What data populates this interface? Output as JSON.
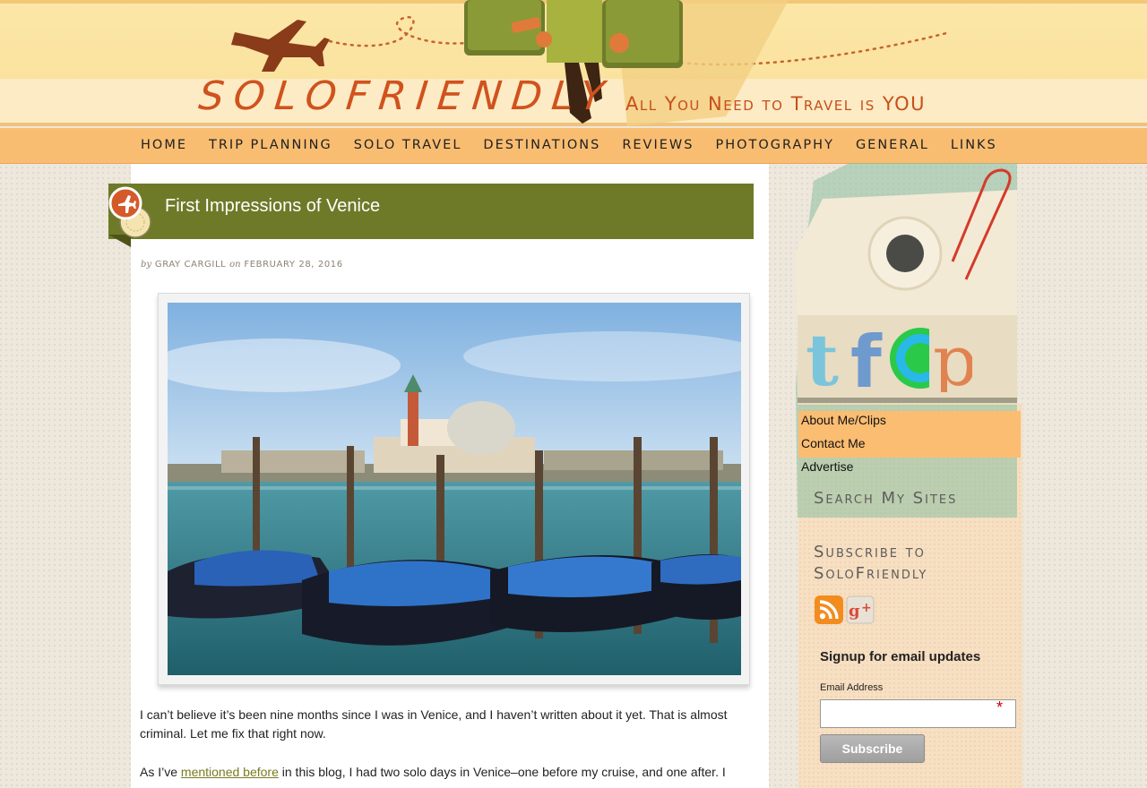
{
  "header": {
    "logo": "SOLOFRIENDLY",
    "tagline": "All You Need to Travel is YOU",
    "colors": {
      "logo": "#d0521d",
      "header_bg": "#fbe7a8",
      "nav_bg": "#f9bd72"
    }
  },
  "nav": {
    "items": [
      "HOME",
      "TRIP PLANNING",
      "SOLO TRAVEL",
      "DESTINATIONS",
      "REVIEWS",
      "PHOTOGRAPHY",
      "GENERAL",
      "LINKS"
    ]
  },
  "post": {
    "title": "First Impressions of Venice",
    "by_prefix": "by",
    "author": "GRAY CARGILL",
    "on_word": "on",
    "date": "FEBRUARY 28, 2016",
    "paragraph1": "I can’t believe it’s been nine months since I was in Venice, and I haven’t written about it yet. That is almost criminal. Let me fix that right now.",
    "paragraph2_before": "As I’ve ",
    "paragraph2_link": "mentioned before",
    "paragraph2_after": " in this blog, I had two solo days in Venice–one before my cruise, and one after. I"
  },
  "sidebar": {
    "social_icons": [
      "twitter-icon",
      "facebook-icon",
      "stumbleupon-icon",
      "pinterest-icon"
    ],
    "links": [
      "About Me/Clips",
      "Contact Me",
      "Advertise"
    ],
    "search_heading": "Search My Sites",
    "subscribe_heading": "Subscribe to SoloFriendly",
    "subscribe_icons": [
      "rss-icon",
      "google-plus-icon"
    ],
    "signup": {
      "title": "Signup for email updates",
      "email_label": "Email Address",
      "required_mark": "*",
      "email_value": "",
      "button": "Subscribe"
    }
  }
}
